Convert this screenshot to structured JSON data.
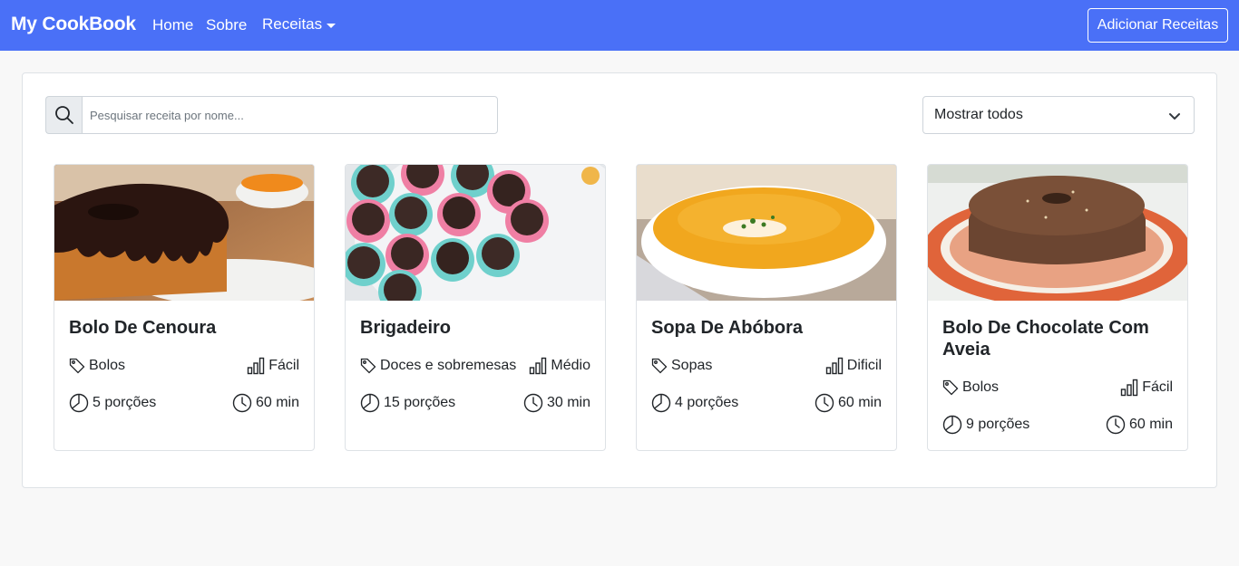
{
  "navbar": {
    "brand": "My CookBook",
    "links": [
      "Home",
      "Sobre"
    ],
    "dropdown_label": "Receitas",
    "add_button": "Adicionar Receitas"
  },
  "search": {
    "placeholder": "Pesquisar receita por nome...",
    "value": ""
  },
  "filter": {
    "selected": "Mostrar todos"
  },
  "recipes": [
    {
      "title": "Bolo De Cenoura",
      "category": "Bolos",
      "difficulty": "Fácil",
      "portions": "5 porções",
      "time": "60 min"
    },
    {
      "title": "Brigadeiro",
      "category": "Doces e sobremesas",
      "difficulty": "Médio",
      "portions": "15 porções",
      "time": "30 min"
    },
    {
      "title": "Sopa De Abóbora",
      "category": "Sopas",
      "difficulty": "Dificil",
      "portions": "4 porções",
      "time": "60 min"
    },
    {
      "title": "Bolo De Chocolate Com Aveia",
      "category": "Bolos",
      "difficulty": "Fácil",
      "portions": "9 porções",
      "time": "60 min"
    }
  ],
  "colors": {
    "navbar": "#4a70f7",
    "page_bg": "#f8f8f8"
  }
}
